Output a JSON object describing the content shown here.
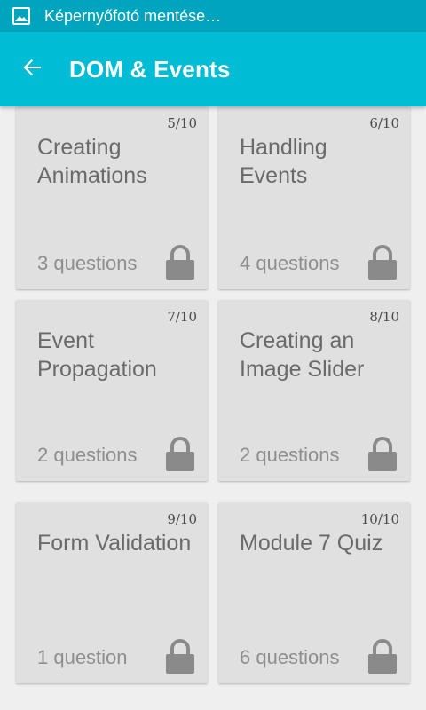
{
  "status_bar": {
    "notification_icon": "image-icon",
    "text": "Képernyőfotó mentése…"
  },
  "app_bar": {
    "back_icon": "arrow-back-icon",
    "title": "DOM & Events"
  },
  "colors": {
    "status_bar": "#00a4bd",
    "app_bar": "#00bcd4",
    "card": "#e0e0e0",
    "lock": "#8a8a8a"
  },
  "lessons": [
    {
      "progress": "5/10",
      "title": "Creating Animations",
      "questions": "3 questions",
      "locked": true,
      "icon": "lock-icon"
    },
    {
      "progress": "6/10",
      "title": "Handling Events",
      "questions": "4 questions",
      "locked": true,
      "icon": "lock-icon"
    },
    {
      "progress": "7/10",
      "title": "Event Propagation",
      "questions": "2 questions",
      "locked": true,
      "icon": "lock-icon"
    },
    {
      "progress": "8/10",
      "title": "Creating an Image Slider",
      "questions": "2 questions",
      "locked": true,
      "icon": "lock-icon"
    },
    {
      "progress": "9/10",
      "title": "Form Validation",
      "questions": "1 question",
      "locked": true,
      "icon": "lock-icon"
    },
    {
      "progress": "10/10",
      "title": "Module 7 Quiz",
      "questions": "6 questions",
      "locked": true,
      "icon": "lock-icon"
    }
  ]
}
